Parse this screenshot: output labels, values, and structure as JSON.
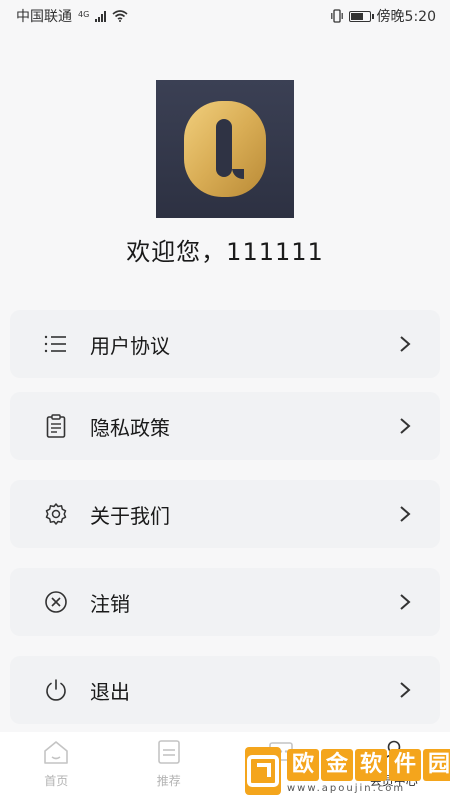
{
  "status_bar": {
    "carrier": "中国联通",
    "network": "4G",
    "time": "傍晚5:20"
  },
  "profile": {
    "welcome": "欢迎您，111111"
  },
  "menu": [
    {
      "label": "用户协议",
      "icon": "list-icon"
    },
    {
      "label": "隐私政策",
      "icon": "clipboard-icon"
    },
    {
      "label": "关于我们",
      "icon": "gear-icon"
    },
    {
      "label": "注销",
      "icon": "circle-x-icon"
    },
    {
      "label": "退出",
      "icon": "power-icon"
    }
  ],
  "tabbar": {
    "tabs": [
      {
        "label": "首页",
        "icon": "home-icon"
      },
      {
        "label": "推荐",
        "icon": "document-icon"
      },
      {
        "label": "",
        "icon": "message-icon"
      },
      {
        "label": "会员中心",
        "icon": "user-icon"
      }
    ]
  },
  "watermark": {
    "title": [
      "欧",
      "金",
      "软",
      "件",
      "园"
    ],
    "url": "www.apoujin.com"
  },
  "colors": {
    "logo_bg": "#2d3142",
    "logo_gold": "#d9ad55",
    "card_bg": "#f1f2f4",
    "watermark": "#f4a51c"
  }
}
